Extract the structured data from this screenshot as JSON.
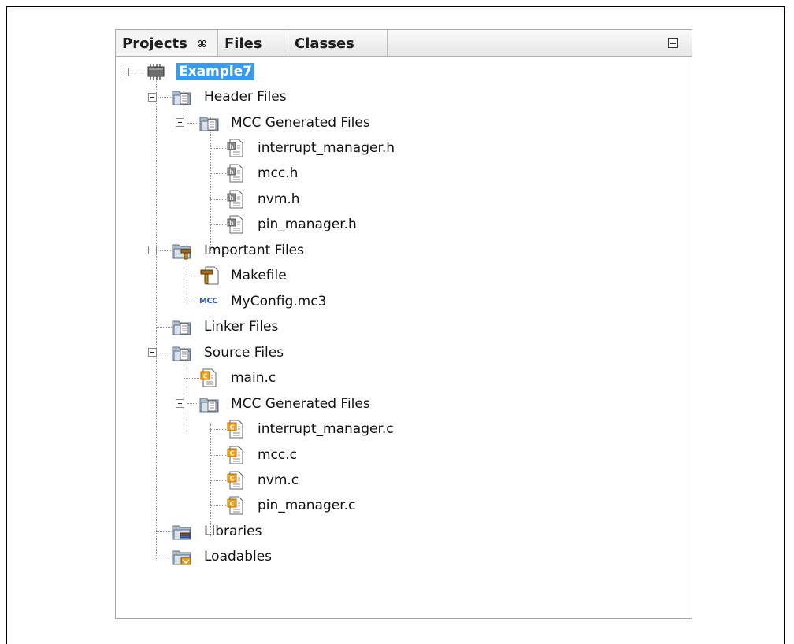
{
  "tabs": [
    {
      "label": "Projects",
      "active": true,
      "close_icon": "⌘"
    },
    {
      "label": "Files"
    },
    {
      "label": "Classes"
    }
  ],
  "tree": {
    "project": {
      "label": "Example7",
      "icon": "chip-icon"
    },
    "nodes": [
      {
        "label": "Header Files",
        "icon": "folder-icon"
      },
      {
        "label": "MCC Generated Files",
        "icon": "folder-icon"
      },
      {
        "label": "interrupt_manager.h",
        "icon": "header-file-icon"
      },
      {
        "label": "mcc.h",
        "icon": "header-file-icon"
      },
      {
        "label": "nvm.h",
        "icon": "header-file-icon"
      },
      {
        "label": "pin_manager.h",
        "icon": "header-file-icon"
      },
      {
        "label": "Important Files",
        "icon": "important-folder-icon"
      },
      {
        "label": "Makefile",
        "icon": "hammer-icon"
      },
      {
        "label": "MyConfig.mc3",
        "icon": "mcc-icon",
        "icon_text": "MCC"
      },
      {
        "label": "Linker Files",
        "icon": "folder-icon"
      },
      {
        "label": "Source Files",
        "icon": "folder-icon"
      },
      {
        "label": "main.c",
        "icon": "c-file-icon"
      },
      {
        "label": "MCC Generated Files",
        "icon": "folder-icon"
      },
      {
        "label": "interrupt_manager.c",
        "icon": "c-file-icon"
      },
      {
        "label": "mcc.c",
        "icon": "c-file-icon"
      },
      {
        "label": "nvm.c",
        "icon": "c-file-icon"
      },
      {
        "label": "pin_manager.c",
        "icon": "c-file-icon"
      },
      {
        "label": "Libraries",
        "icon": "libraries-folder-icon"
      },
      {
        "label": "Loadables",
        "icon": "loadables-folder-icon"
      }
    ]
  },
  "colors": {
    "selection": "#3d9ae8",
    "folder": "#8aa0b8",
    "c_badge": "#f0a020",
    "mcc_text": "#2a5db0"
  }
}
